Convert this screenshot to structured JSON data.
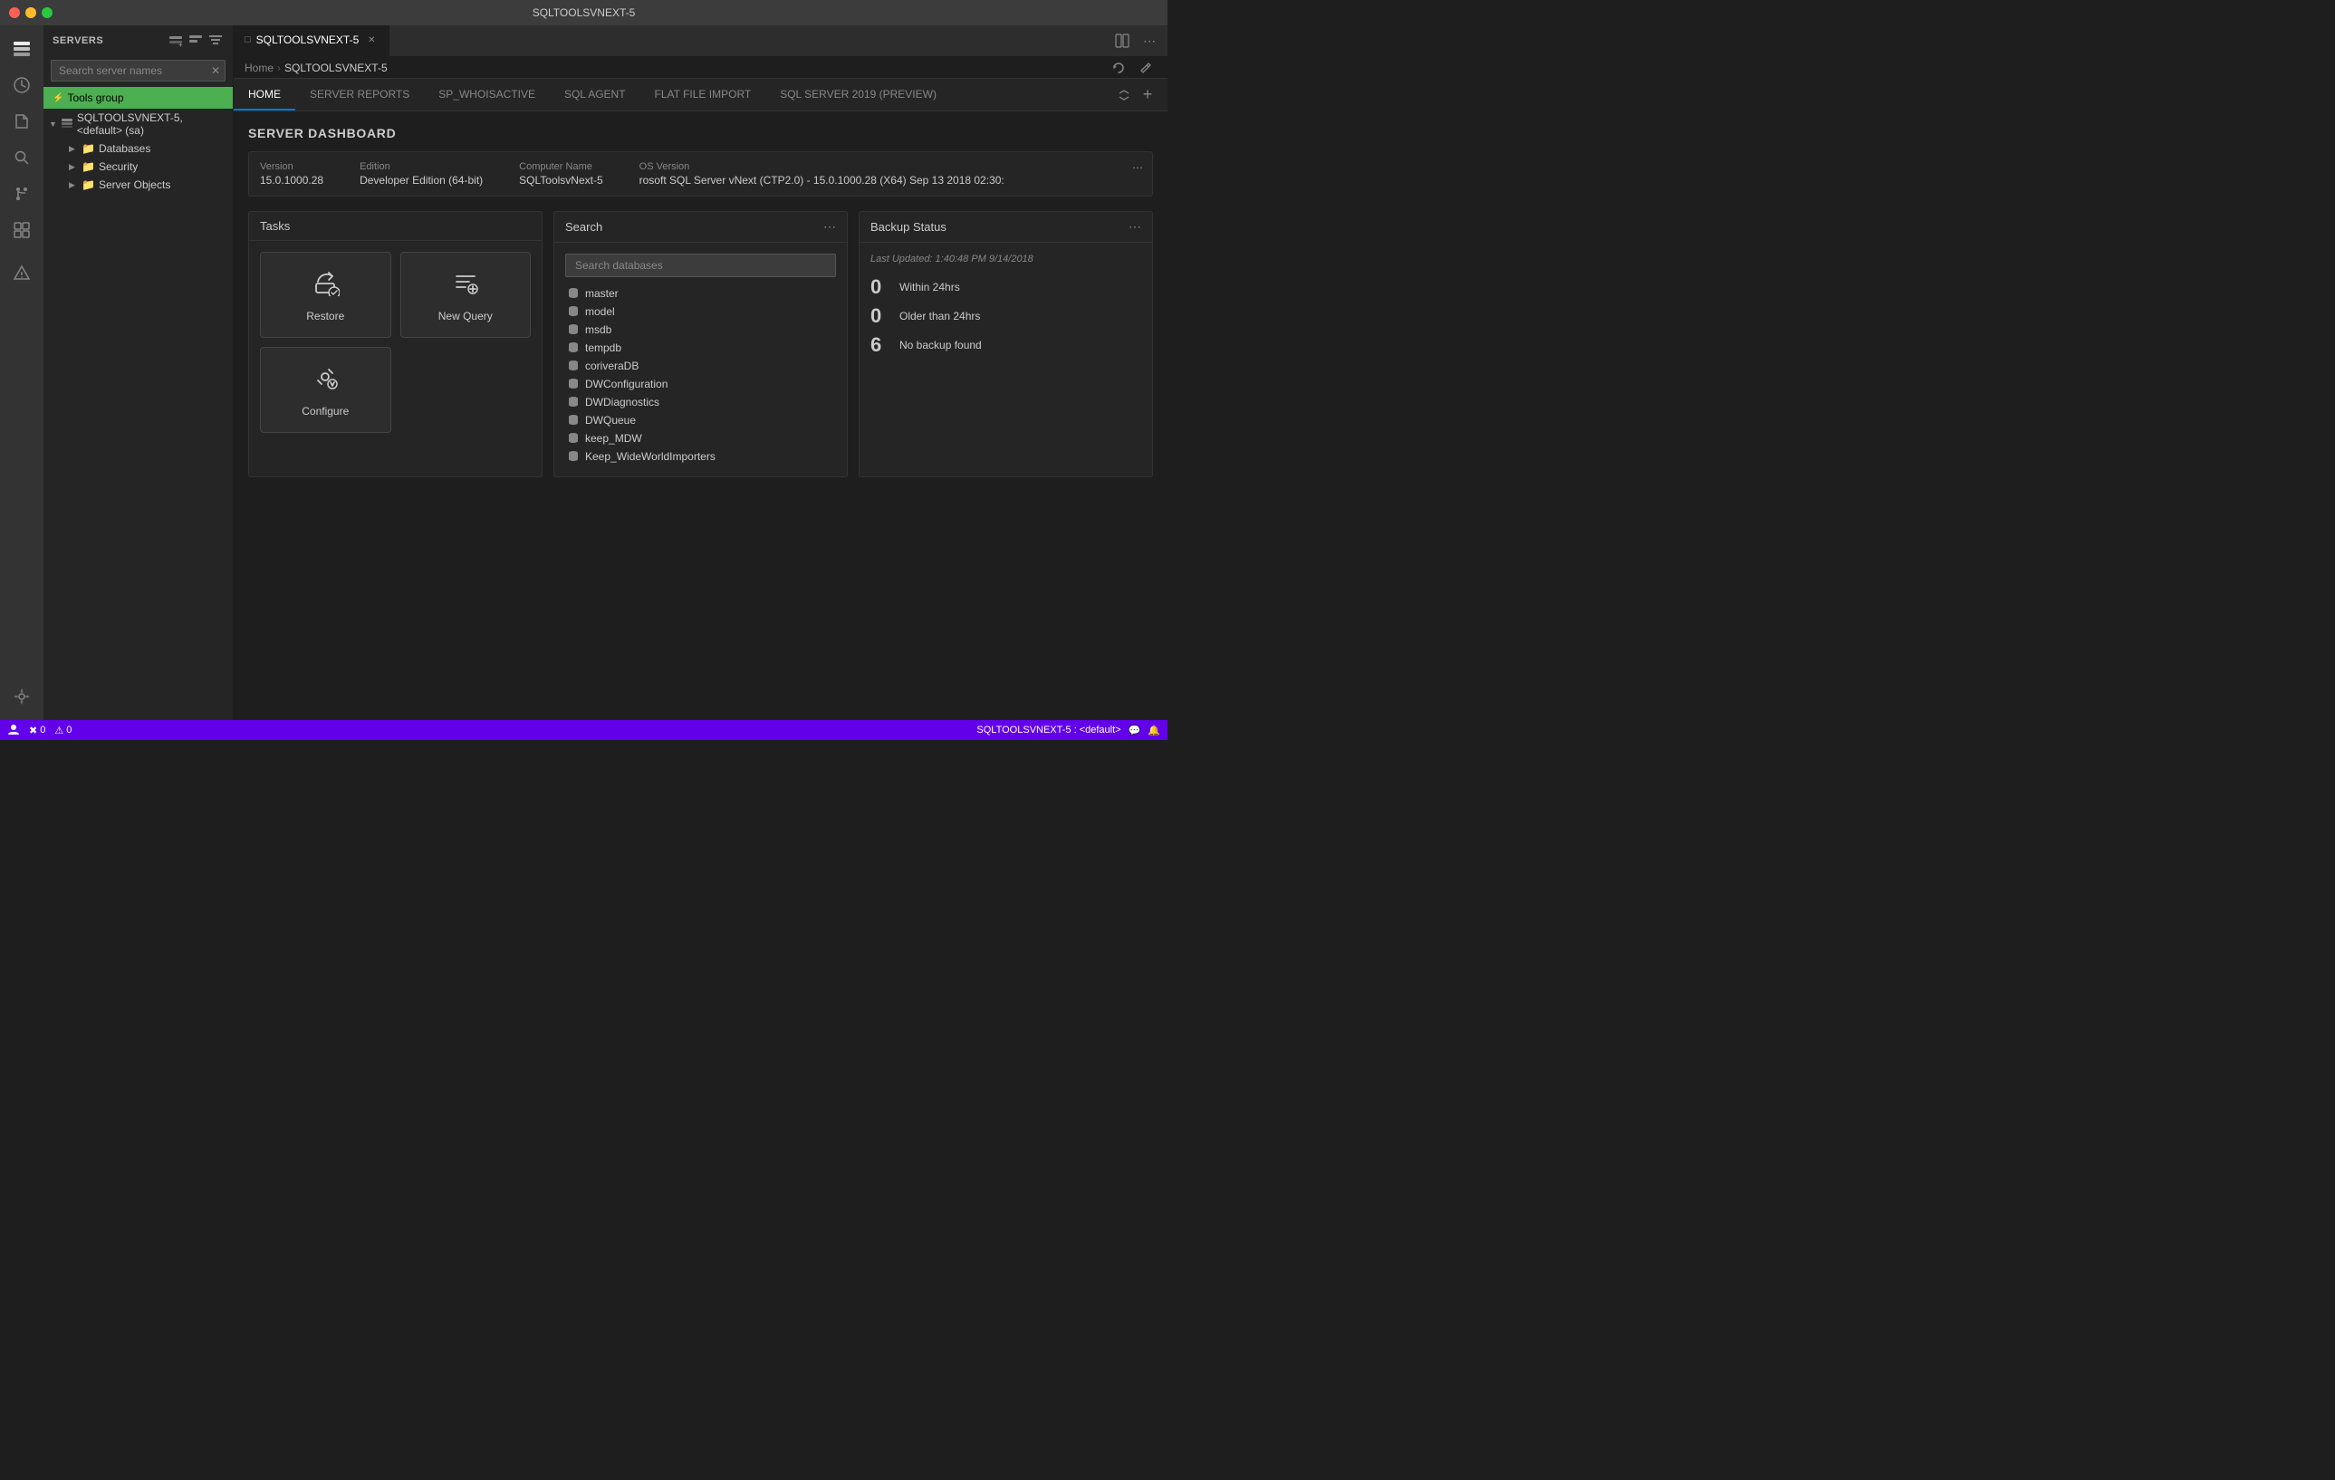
{
  "window": {
    "title": "SQLTOOLSVNEXT-5"
  },
  "titlebar": {
    "title": "SQLTOOLSVNEXT-5",
    "traffic_lights": [
      "red",
      "yellow",
      "green"
    ]
  },
  "activity_bar": {
    "icons": [
      {
        "name": "servers-icon",
        "symbol": "⊞",
        "active": true
      },
      {
        "name": "history-icon",
        "symbol": "🕐",
        "active": false
      },
      {
        "name": "files-icon",
        "symbol": "📄",
        "active": false
      },
      {
        "name": "search-icon",
        "symbol": "🔍",
        "active": false
      },
      {
        "name": "git-icon",
        "symbol": "⑂",
        "active": false
      },
      {
        "name": "extensions-icon",
        "symbol": "⊡",
        "active": false
      },
      {
        "name": "triangle-icon",
        "symbol": "△",
        "active": false
      }
    ],
    "bottom_icon": {
      "name": "settings-icon",
      "symbol": "⚙"
    }
  },
  "sidebar": {
    "header": "SERVERS",
    "search_placeholder": "Search server names",
    "tools_group": "Tools group",
    "server": {
      "name": "SQLTOOLSVNEXT-5, <default> (sa)",
      "children": [
        {
          "label": "Databases",
          "type": "folder"
        },
        {
          "label": "Security",
          "type": "folder"
        },
        {
          "label": "Server Objects",
          "type": "folder"
        }
      ]
    }
  },
  "tab_bar": {
    "active_tab": {
      "label": "SQLTOOLSVNEXT-5",
      "icon": "□"
    }
  },
  "breadcrumb": {
    "items": [
      {
        "label": "Home",
        "current": false
      },
      {
        "label": "SQLTOOLSVNEXT-5",
        "current": true
      }
    ]
  },
  "content_tabs": {
    "tabs": [
      {
        "label": "HOME",
        "active": true
      },
      {
        "label": "SERVER REPORTS",
        "active": false
      },
      {
        "label": "SP_WHOISACTIVE",
        "active": false
      },
      {
        "label": "SQL AGENT",
        "active": false
      },
      {
        "label": "FLAT FILE IMPORT",
        "active": false
      },
      {
        "label": "SQL SERVER 2019 (PREVIEW)",
        "active": false
      }
    ]
  },
  "dashboard": {
    "title": "SERVER DASHBOARD",
    "server_info": {
      "version_label": "Version",
      "version_value": "15.0.1000.28",
      "edition_label": "Edition",
      "edition_value": "Developer Edition (64-bit)",
      "computer_label": "Computer Name",
      "computer_value": "SQLToolsvNext-5",
      "os_label": "OS Version",
      "os_value": "rosoft SQL Server vNext (CTP2.0) - 15.0.1000.28 (X64)  Sep 13 2018 02:30:"
    },
    "tasks_panel": {
      "title": "Tasks",
      "cards": [
        {
          "label": "Restore",
          "icon": "restore"
        },
        {
          "label": "New Query",
          "icon": "newquery"
        },
        {
          "label": "Configure",
          "icon": "configure"
        }
      ]
    },
    "search_panel": {
      "title": "Search",
      "search_placeholder": "Search databases",
      "databases": [
        "master",
        "model",
        "msdb",
        "tempdb",
        "coriveraDB",
        "DWConfiguration",
        "DWDiagnostics",
        "DWQueue",
        "keep_MDW",
        "Keep_WideWorldImporters"
      ]
    },
    "backup_panel": {
      "title": "Backup Status",
      "last_updated": "Last Updated: 1:40:48 PM 9/14/2018",
      "stats": [
        {
          "count": "0",
          "label": "Within 24hrs"
        },
        {
          "count": "0",
          "label": "Older than 24hrs"
        },
        {
          "count": "6",
          "label": "No backup found"
        }
      ]
    }
  },
  "status_bar": {
    "left": {
      "icon": "👤",
      "errors": {
        "count": "0",
        "icon": "✖"
      },
      "warnings": {
        "count": "0",
        "icon": "⚠"
      }
    },
    "right": {
      "connection": "SQLTOOLSVNEXT-5 : <default>",
      "notification_icon": "🔔",
      "message_icon": "💬"
    }
  }
}
